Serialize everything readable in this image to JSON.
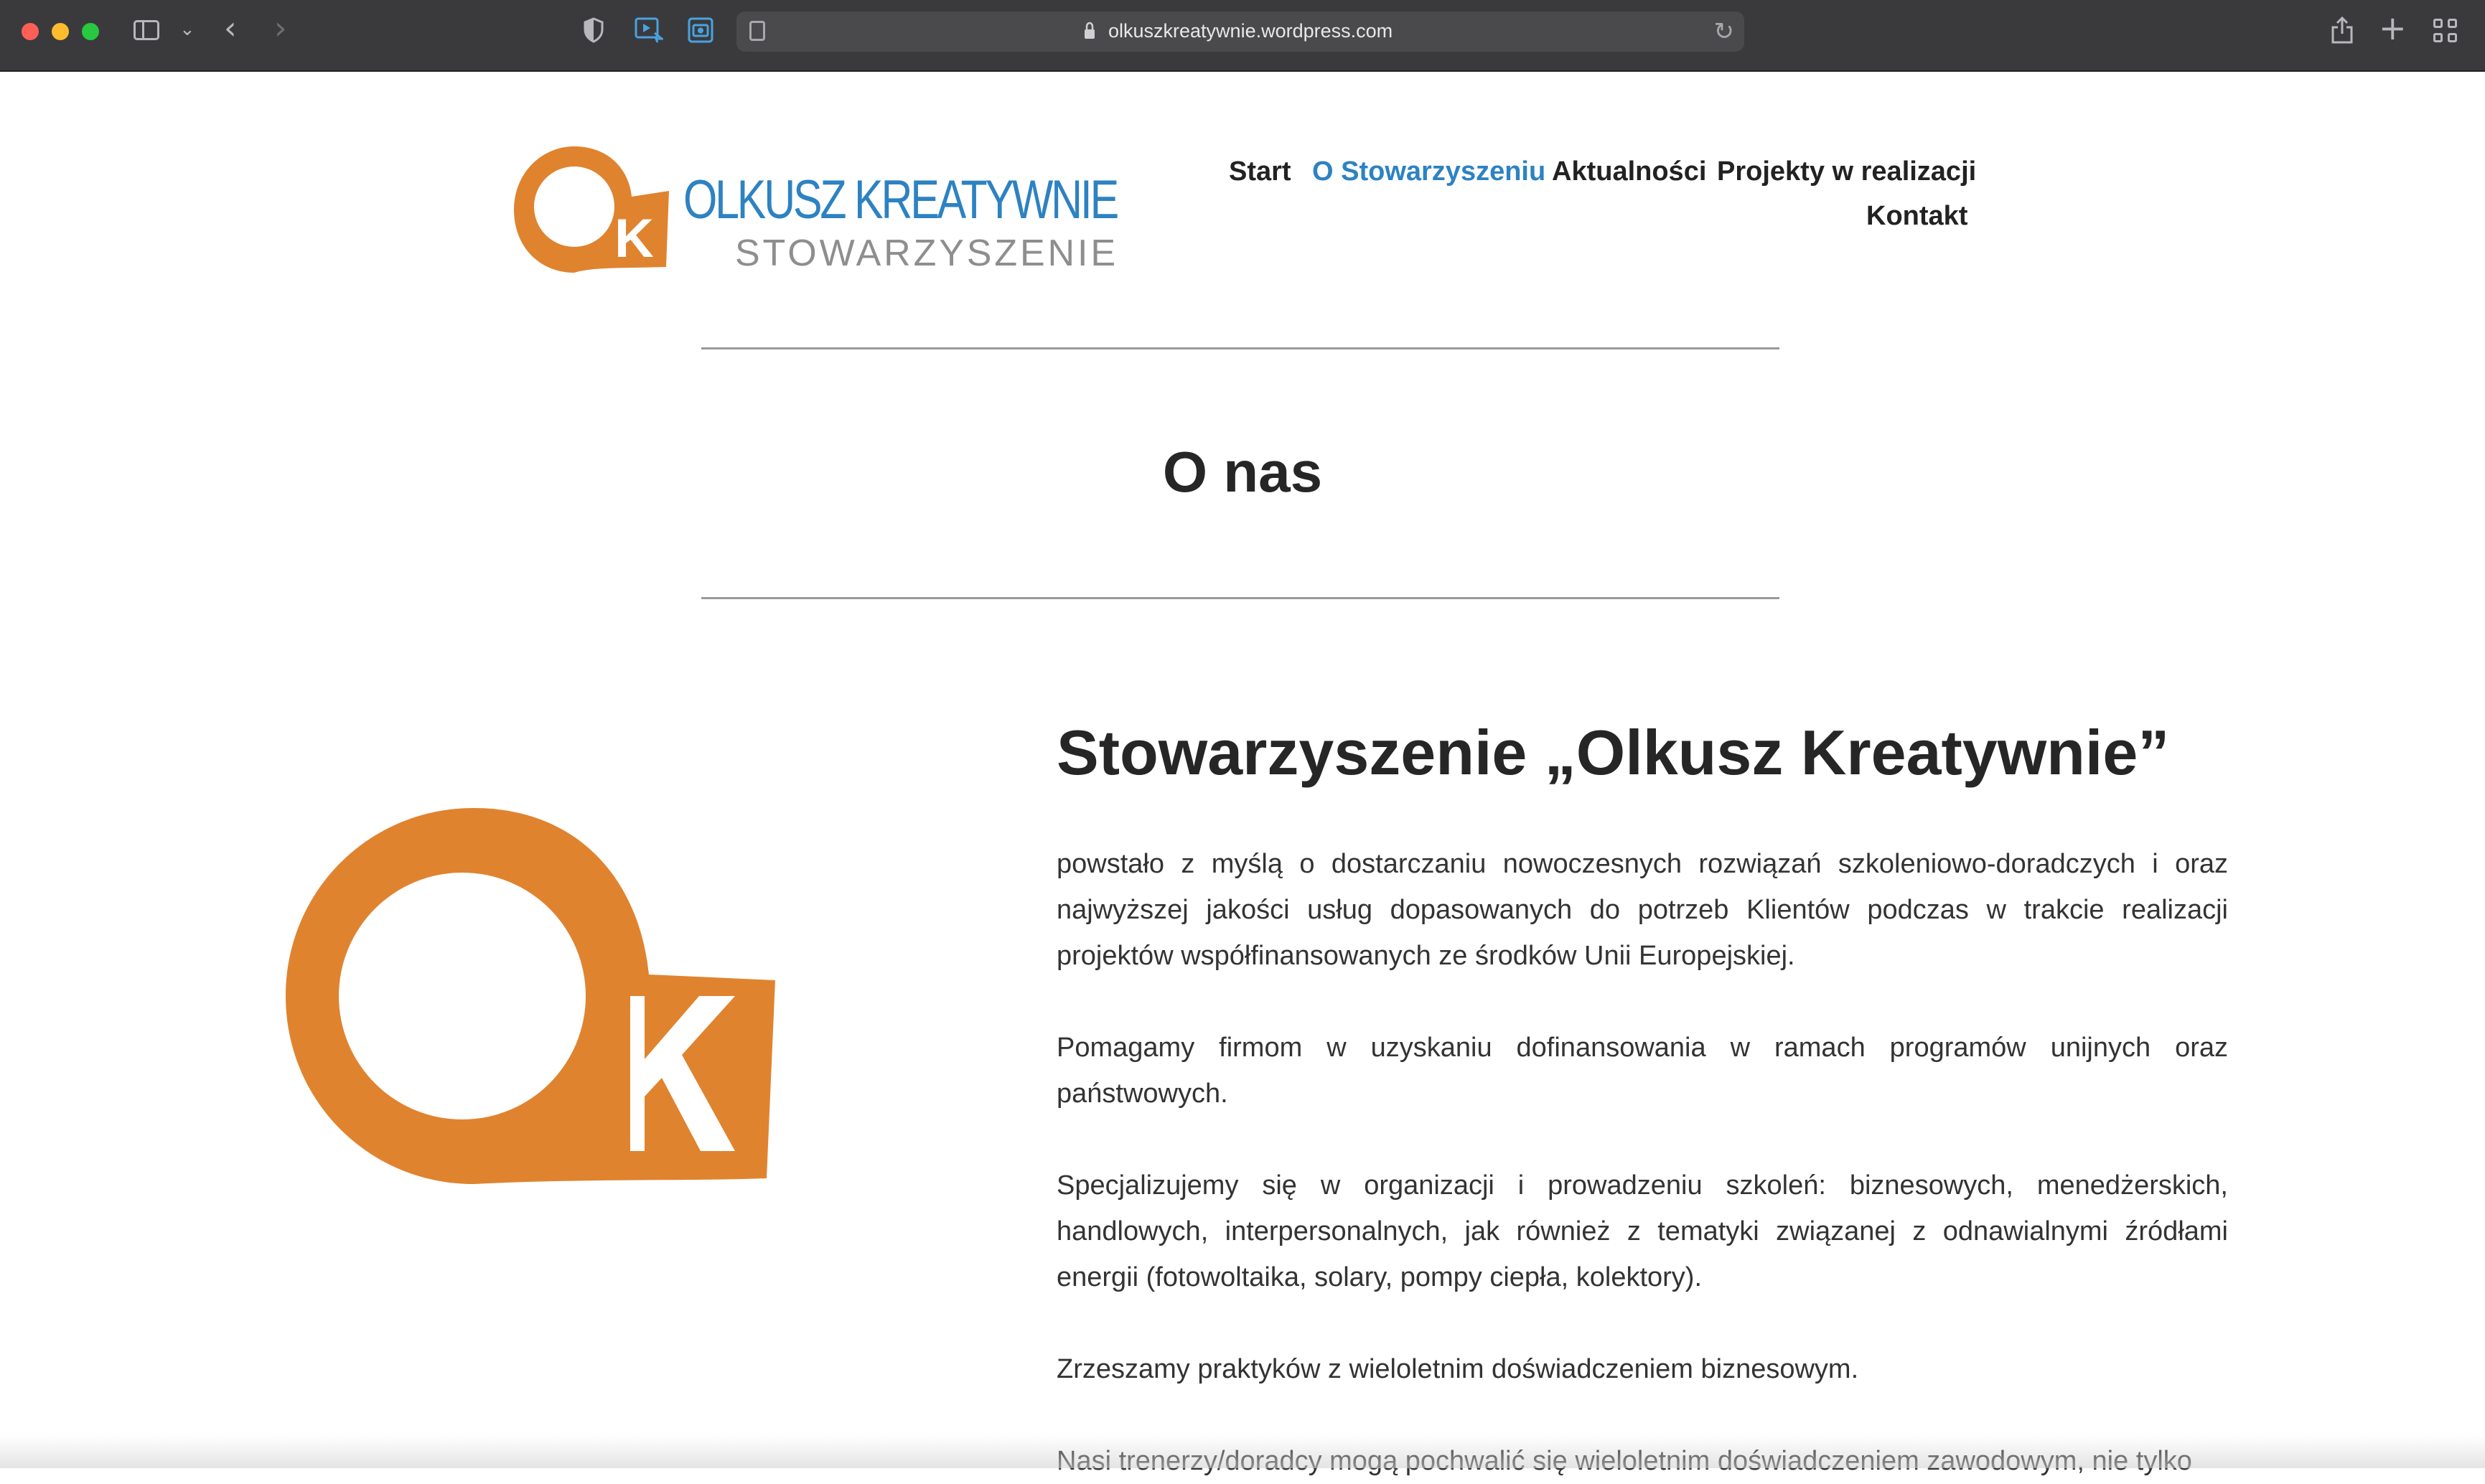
{
  "browser": {
    "url": "olkuszkreatywnie.wordpress.com",
    "icons": [
      "close-window-icon",
      "minimize-window-icon",
      "zoom-window-icon",
      "sidebar-icon",
      "chevron-down-icon",
      "back-arrow-icon",
      "forward-arrow-icon",
      "privacy-shield-icon",
      "extension-icon",
      "screenshot-extension-icon",
      "reader-icon",
      "lock-icon",
      "reload-icon",
      "share-icon",
      "new-tab-icon",
      "tab-overview-icon"
    ]
  },
  "site": {
    "logo_title": "OLKUSZ KREATYWNIE",
    "logo_subtitle": "STOWARZYSZENIE",
    "logo_mark_letter": "K",
    "brand_orange": "#e0832f",
    "brand_blue": "#2d82c2"
  },
  "nav": {
    "items": [
      {
        "label": "Start",
        "active": false
      },
      {
        "label": "O Stowarzyszeniu",
        "active": true
      },
      {
        "label": "Aktualności",
        "active": false
      },
      {
        "label": "Projekty w realizacji",
        "active": false
      },
      {
        "label": "Kontakt",
        "active": false
      }
    ]
  },
  "page": {
    "title": "O nas",
    "heading": "Stowarzyszenie „Olkusz Kreatywnie”",
    "paragraphs": [
      "powstało z myślą o dostarczaniu nowoczesnych rozwiązań szkoleniowo-doradczych i oraz najwyższej jakości usług dopasowanych do potrzeb Klientów podczas w trakcie realizacji projektów współfinansowanych ze środków Unii Europejskiej.",
      "Pomagamy firmom w uzyskaniu dofinansowania w ramach programów unijnych oraz państwowych.",
      "Specjalizujemy się w organizacji i prowadzeniu szkoleń: biznesowych, menedżerskich, handlowych, interpersonalnych, jak również z tematyki związanej z odnawialnymi źródłami energii (fotowoltaika, solary, pompy ciepła, kolektory).",
      "Zrzeszamy praktyków z wieloletnim doświadczeniem biznesowym.",
      "Nasi trenerzy/doradcy mogą pochwalić się wieloletnim doświadczeniem zawodowym, nie tylko"
    ]
  }
}
